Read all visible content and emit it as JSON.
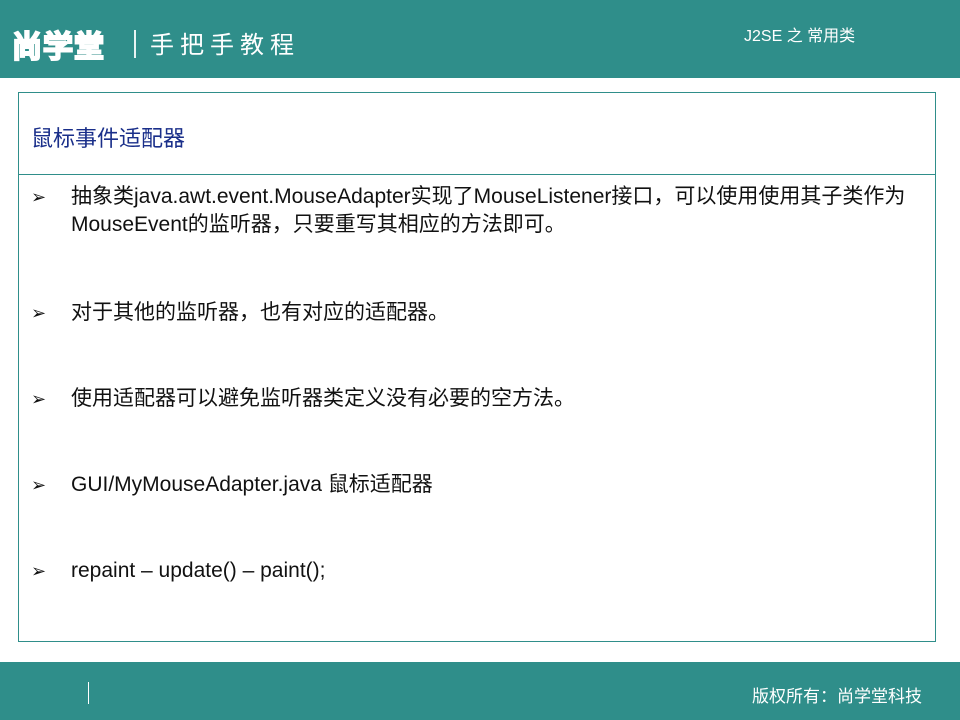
{
  "header": {
    "logo_text": "尚学堂",
    "tagline": "手把手教程",
    "topic": "J2SE 之 常用类"
  },
  "slide": {
    "title": "鼠标事件适配器",
    "bullet_marker": "➢",
    "bullets": [
      {
        "text": "抽象类java.awt.event.MouseAdapter实现了MouseListener接口，可以使用使用其子类作为MouseEvent的监听器，只要重写其相应的方法即可。"
      },
      {
        "text": "对于其他的监听器，也有对应的适配器。"
      },
      {
        "text": "使用适配器可以避免监听器类定义没有必要的空方法。"
      },
      {
        "text": "GUI/MyMouseAdapter.java 鼠标适配器"
      },
      {
        "text": "repaint – update() – paint();"
      }
    ]
  },
  "footer": {
    "copyright": "版权所有：尚学堂科技"
  },
  "colors": {
    "brand_teal": "#2f8e8a",
    "title_blue": "#1a2f8a"
  }
}
